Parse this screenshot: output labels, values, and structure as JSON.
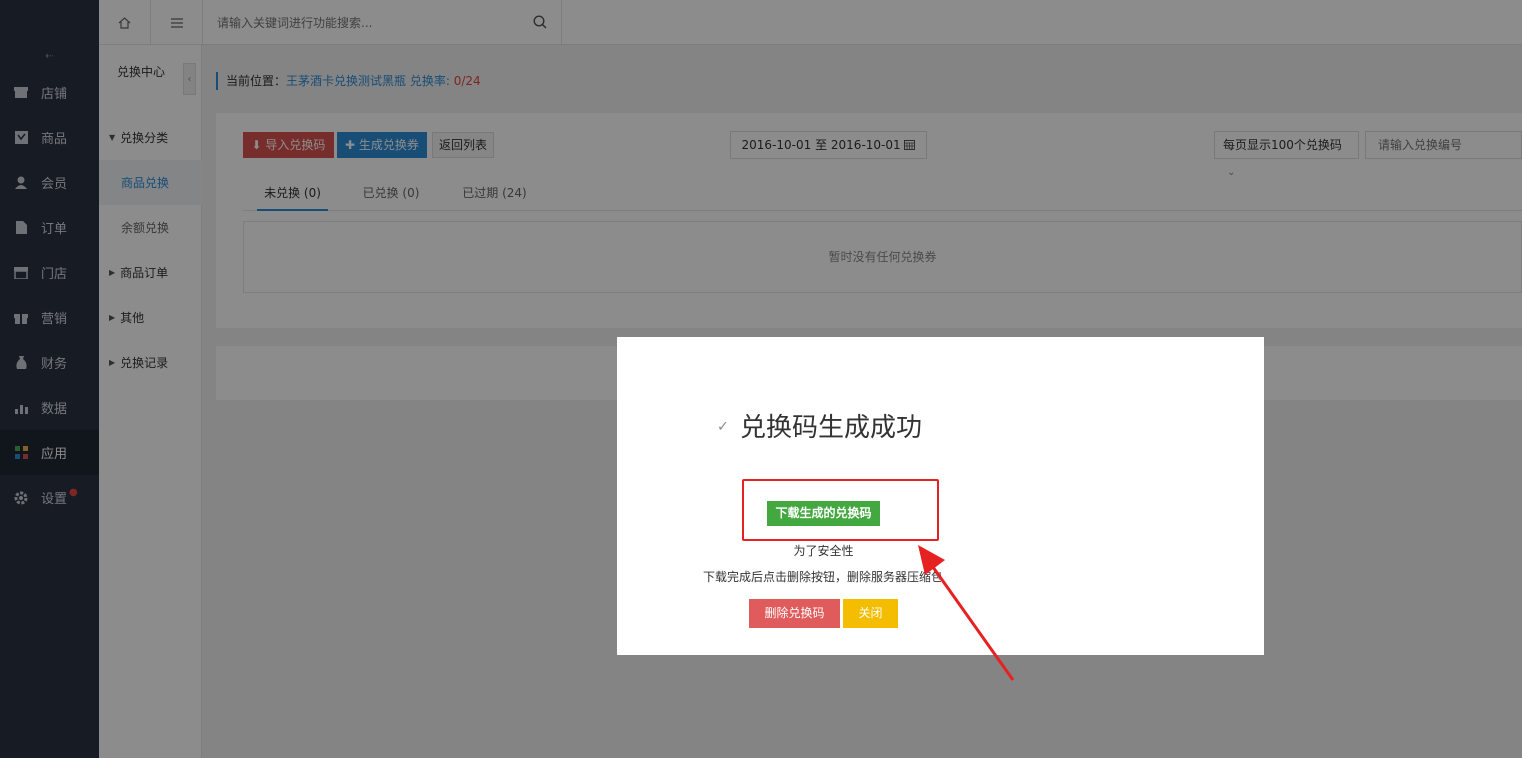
{
  "nav": {
    "collapse_label": "⇠",
    "items": [
      {
        "label": "店铺",
        "icon": "store-icon"
      },
      {
        "label": "商品",
        "icon": "goods-icon"
      },
      {
        "label": "会员",
        "icon": "member-icon"
      },
      {
        "label": "订单",
        "icon": "order-icon"
      },
      {
        "label": "门店",
        "icon": "shop-icon"
      },
      {
        "label": "营销",
        "icon": "gift-icon"
      },
      {
        "label": "财务",
        "icon": "money-icon"
      },
      {
        "label": "数据",
        "icon": "chart-icon"
      },
      {
        "label": "应用",
        "icon": "apps-icon"
      },
      {
        "label": "设置",
        "icon": "gear-icon"
      }
    ],
    "settings_badge": "●"
  },
  "topbar": {
    "search_placeholder": "请输入关键词进行功能搜索..."
  },
  "subnav": {
    "title": "兑换中心",
    "toggle": "‹",
    "items": [
      {
        "label": "兑换分类"
      },
      {
        "label": "商品兑换"
      },
      {
        "label": "余额兑换"
      },
      {
        "label": "商品订单"
      },
      {
        "label": "其他"
      },
      {
        "label": "兑换记录"
      }
    ]
  },
  "breadcrumb": {
    "prefix": "当前位置：",
    "link": "王茅酒卡兑换测试黑瓶 兑换率:",
    "rate": " 0/24"
  },
  "toolbar": {
    "import_label": "导入兑换码",
    "generate_label": "生成兑换券",
    "back_label": "返回列表",
    "date_range": "2016-10-01 至 2016-10-01",
    "per_page": "每页显示100个兑换码",
    "code_placeholder": "请输入兑换编号"
  },
  "tabs": [
    {
      "label": "未兑换 (0)"
    },
    {
      "label": "已兑换 (0)"
    },
    {
      "label": "已过期 (24)"
    }
  ],
  "empty_text": "暂时没有任何兑换券",
  "modal": {
    "check": "✓",
    "title": "兑换码生成成功",
    "download_label": "下载生成的兑换码",
    "note1": "为了安全性",
    "note2": "下载完成后点击删除按钮，删除服务器压缩包",
    "delete_label": "删除兑换码",
    "close_label": "关闭"
  },
  "colors": {
    "accent": "#2d8cd7",
    "annotation": "#e62121"
  }
}
